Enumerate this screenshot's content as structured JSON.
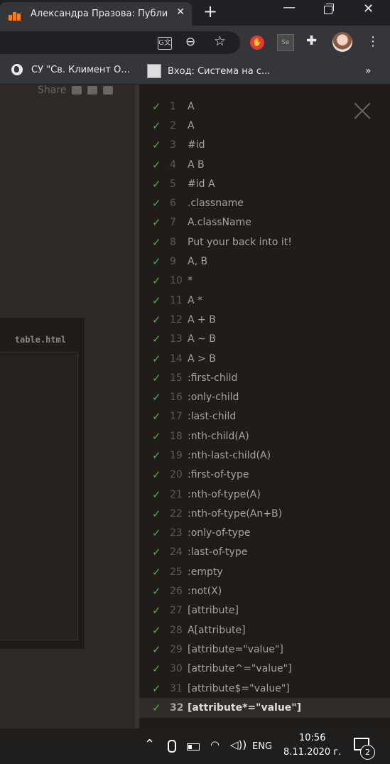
{
  "browser": {
    "tab_title": "Александра Празова: Публи",
    "tab_close": "✕",
    "new_tab": "+",
    "window": {
      "minimize": "—",
      "close": "✕"
    },
    "toolbar": {
      "translate_icon": "G文",
      "zoom_icon": "⊖",
      "star_icon": "☆",
      "adblock_icon": "✋",
      "se_ext": "Se",
      "puzzle_icon": "✚",
      "menu_icon": "⋮"
    },
    "bookmarks": [
      {
        "label": "СУ \"Св. Климент О...",
        "icon": "globe-icon"
      },
      {
        "label": "Вход: Система на с...",
        "icon": "emblem-icon"
      }
    ],
    "bookmarks_more": "»"
  },
  "page": {
    "share_label": "Share",
    "editor_filename": "table.html"
  },
  "levels": [
    {
      "n": "1",
      "sel": "A",
      "done": true
    },
    {
      "n": "2",
      "sel": "A",
      "done": true
    },
    {
      "n": "3",
      "sel": "#id",
      "done": true
    },
    {
      "n": "4",
      "sel": "A  B",
      "done": true
    },
    {
      "n": "5",
      "sel": "#id  A",
      "done": true
    },
    {
      "n": "6",
      "sel": ".classname",
      "done": true
    },
    {
      "n": "7",
      "sel": "A.className",
      "done": true
    },
    {
      "n": "8",
      "sel": "Put your back into it!",
      "done": true
    },
    {
      "n": "9",
      "sel": "A, B",
      "done": true
    },
    {
      "n": "10",
      "sel": "*",
      "done": true
    },
    {
      "n": "11",
      "sel": "A  *",
      "done": true
    },
    {
      "n": "12",
      "sel": "A + B",
      "done": true
    },
    {
      "n": "13",
      "sel": "A ~ B",
      "done": true
    },
    {
      "n": "14",
      "sel": "A > B",
      "done": true
    },
    {
      "n": "15",
      "sel": ":first-child",
      "done": true
    },
    {
      "n": "16",
      "sel": ":only-child",
      "done": true
    },
    {
      "n": "17",
      "sel": ":last-child",
      "done": true
    },
    {
      "n": "18",
      "sel": ":nth-child(A)",
      "done": true
    },
    {
      "n": "19",
      "sel": ":nth-last-child(A)",
      "done": true
    },
    {
      "n": "20",
      "sel": ":first-of-type",
      "done": true
    },
    {
      "n": "21",
      "sel": ":nth-of-type(A)",
      "done": true
    },
    {
      "n": "22",
      "sel": ":nth-of-type(An+B)",
      "done": true
    },
    {
      "n": "23",
      "sel": ":only-of-type",
      "done": true
    },
    {
      "n": "24",
      "sel": ":last-of-type",
      "done": true
    },
    {
      "n": "25",
      "sel": ":empty",
      "done": true
    },
    {
      "n": "26",
      "sel": ":not(X)",
      "done": true
    },
    {
      "n": "27",
      "sel": "[attribute]",
      "done": true
    },
    {
      "n": "28",
      "sel": "A[attribute]",
      "done": true
    },
    {
      "n": "29",
      "sel": "[attribute=\"value\"]",
      "done": true
    },
    {
      "n": "30",
      "sel": "[attribute^=\"value\"]",
      "done": true
    },
    {
      "n": "31",
      "sel": "[attribute$=\"value\"]",
      "done": true
    },
    {
      "n": "32",
      "sel": "[attribute*=\"value\"]",
      "done": true,
      "current": true
    }
  ],
  "check_glyph": "✓",
  "taskbar": {
    "chevron": "⌃",
    "wifi_icon": "◠",
    "speaker_icon": "◁))",
    "language": "ENG",
    "time": "10:56",
    "date": "8.11.2020 г.",
    "notification_count": "2"
  }
}
